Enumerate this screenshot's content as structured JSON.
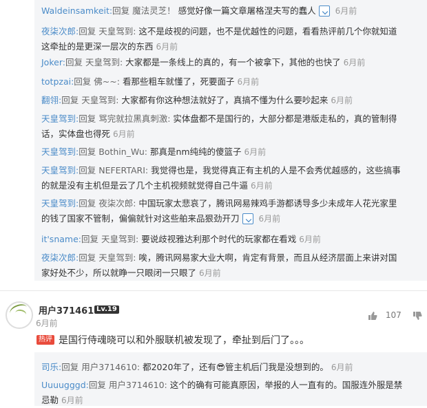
{
  "replies": [
    {
      "user": "Waldeinsamkeit:",
      "prefix": "回复",
      "target": "魔法灵芝！",
      "text": "感觉好像一篇文章屠格涅夫写的蠢人",
      "has_image": true,
      "time": "6月前"
    },
    {
      "user": "夜柒次郎:",
      "prefix": "回复",
      "target": "天皇驾到:",
      "text": "这不是歧视的问题，也不是优越性的问题，看看热评前几个你就知道",
      "text2": "这牵扯的是更深一层次的东西",
      "time": "6月前"
    },
    {
      "user": "Joker:",
      "prefix": "回复",
      "target": "天皇驾到:",
      "text": "大家都是一条线上的真的，有一个被拿下，其他的也快了",
      "time": "6月前"
    },
    {
      "user": "totpzai:",
      "prefix": "回复",
      "target": "佛~~:",
      "text": "看那些粗车就懂了，死要面子",
      "time": "6月前"
    },
    {
      "user": "翻翎:",
      "prefix": "回复",
      "target": "天皇驾到:",
      "text": "大家都有你这种想法就好了，真搞不懂为什么要吵起来",
      "time": "6月前"
    },
    {
      "user": "天皇驾到:",
      "prefix": "回复",
      "target": "骂完就拉黑真刺激:",
      "text": "实体盘都不是国行的，大部分都是港版走私的，真的管制得",
      "text2": "话，实体盘也得死",
      "time": "6月前"
    },
    {
      "user": "天皇驾到:",
      "prefix": "回复",
      "target": "Bothin_Wu:",
      "text": "那真是nm纯纯的傻篮子",
      "time": "6月前"
    },
    {
      "user": "天皇驾到:",
      "prefix": "回复",
      "target": "NEFERTARI:",
      "text": "我觉得也是，我觉得真正有主机的人是不会秀优越感的，这些搞事",
      "text2": "的就是没有主机但是云了几个主机视频就觉得自己牛逼",
      "time": "6月前"
    },
    {
      "user": "天皇驾到:",
      "prefix": "回复",
      "target": "夜柒次郎:",
      "text": "中国玩家太悲哀了，腾讯网易辣鸡手游都诱导多少未成年人花光家里",
      "text2": "的钱了国家不管制，偏偏就针对这些舶来品狠劲开刀",
      "has_image2": true,
      "time": "6月前"
    },
    {
      "user": "it'sname:",
      "prefix": "回复",
      "target": "天皇驾到:",
      "text": "要说歧视雅达利那个时代的玩家都在看戏",
      "time": "6月前"
    },
    {
      "user": "夜柒次郎:",
      "prefix": "回复",
      "target": "天皇驾到:",
      "text": "唉，腾讯网易家大业大啊，肯定有背景，而且从经济层面上来讲对国",
      "text2": "家好处不少，所以就睁一只眼闭一只眼了",
      "time": "6月前"
    }
  ],
  "comment": {
    "username": "用户3714610",
    "level": "Lv.19",
    "time": "6月前",
    "likes": "107",
    "hot_tag": "热评",
    "text": "是国行侍魂晓可以和外服联机被发现了，牵扯到后门了。。。"
  },
  "sub_replies": [
    {
      "user": "司乐:",
      "prefix": "回复",
      "target": "用户3714610:",
      "text": "都2020年了，还有😎管主机后门我是没想到的。",
      "time": "6月前"
    },
    {
      "user": "Uuuugggd:",
      "prefix": "回复",
      "target": "用户3714610:",
      "text": "这个的确有可能真原因，举报的人一直有的。国服连外服是禁",
      "text2": "忌勒",
      "time": "6月前"
    }
  ]
}
